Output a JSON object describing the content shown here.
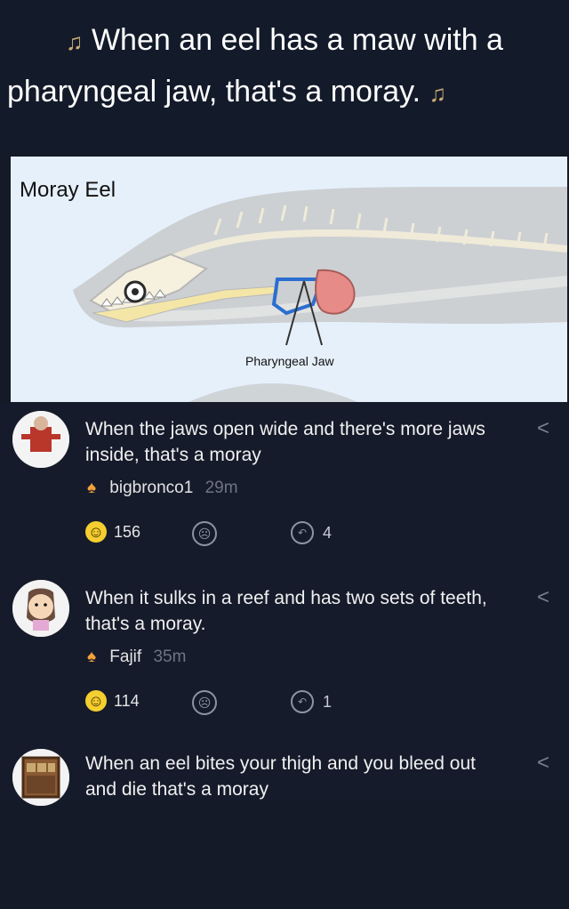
{
  "header": {
    "line1": "When an eel has a maw with a",
    "line2": "pharyngeal jaw, that's a moray.",
    "note_icon": "music-note-icon",
    "note_glyph": "♫"
  },
  "figure": {
    "title": "Moray Eel",
    "label": "Pharyngeal Jaw"
  },
  "comments": [
    {
      "text": "When the jaws open wide and there's more jaws inside, that's a moray",
      "author": "bigbronco1",
      "time": "29m",
      "likes": "156",
      "replies": "4",
      "badge_icon": "flame-icon",
      "like_icon": "smile-icon",
      "dislike_icon": "sad-face-icon",
      "reply_icon": "reply-icon",
      "more_icon": "chevron-left-icon"
    },
    {
      "text": "When it sulks in a reef and has two sets of teeth, that's a moray.",
      "author": "Fajif",
      "time": "35m",
      "likes": "114",
      "replies": "1",
      "badge_icon": "flame-icon",
      "like_icon": "smile-icon",
      "dislike_icon": "sad-face-icon",
      "reply_icon": "reply-icon",
      "more_icon": "chevron-left-icon"
    },
    {
      "text": "When an eel bites your thigh and you bleed out and die that's a moray",
      "more_icon": "chevron-left-icon"
    }
  ],
  "colors": {
    "background": "#141a28",
    "accent": "#f4cf2f",
    "flame": "#f5a23a",
    "muted": "#6f7485"
  }
}
